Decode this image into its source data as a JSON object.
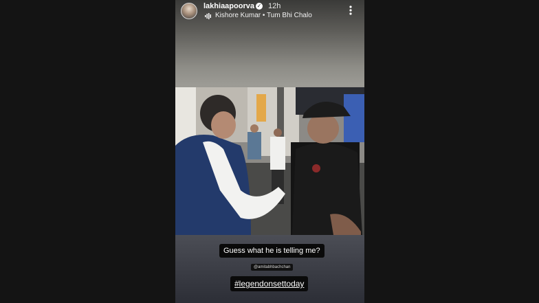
{
  "story": {
    "username": "lakhiaapoorva",
    "timestamp": "12h",
    "music": "Kishore Kumar • Tum Bhi Chalo",
    "caption": "Guess what he is telling me?",
    "mention": "@amitabhbachchan",
    "hashtag": "#legendonsettoday"
  },
  "icons": [
    "verified-badge-icon",
    "music-icon",
    "more-options-icon"
  ],
  "colors": {
    "background": "#141414",
    "text": "#ffffff",
    "sticker_bg": "#0a0a0a"
  }
}
